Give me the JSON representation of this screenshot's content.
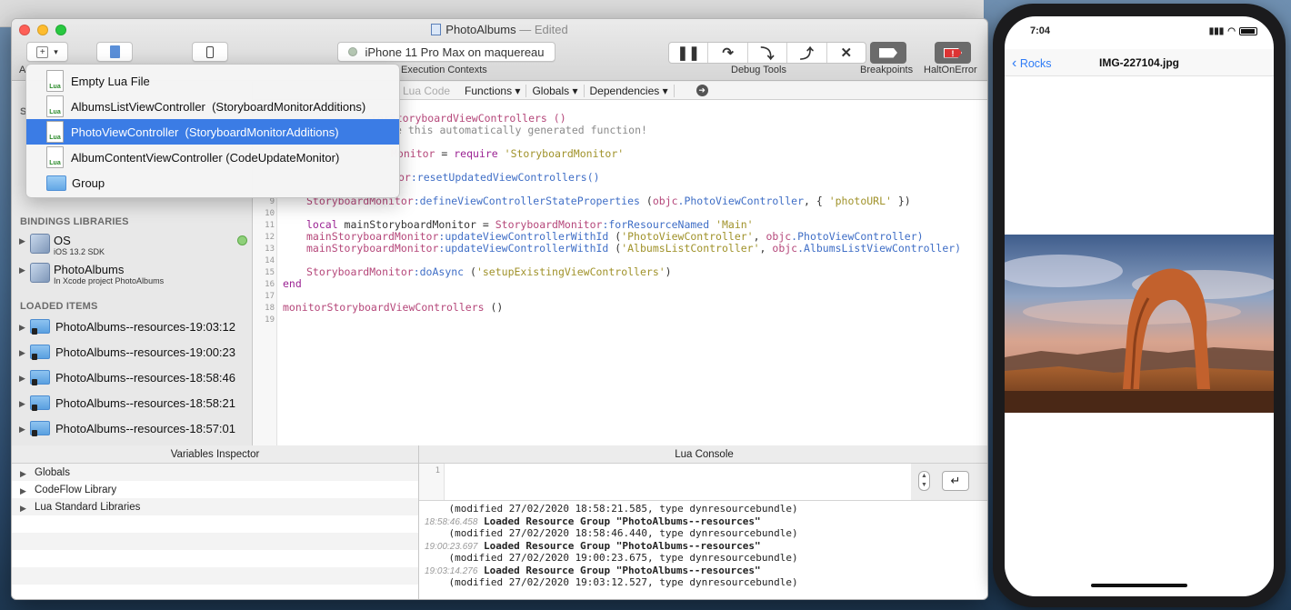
{
  "window": {
    "title": "PhotoAlbums",
    "edited": "— Edited"
  },
  "toolbar": {
    "device": "iPhone 11 Pro Max on maquereau",
    "execution_contexts_label": "Execution Contexts",
    "debug_tools_label": "Debug Tools",
    "breakpoints_label": "Breakpoints",
    "halt_on_error_label": "HaltOnError",
    "partial_label": "A"
  },
  "menu": {
    "items": [
      {
        "label": "Empty Lua File",
        "icon": "lua-file-icon"
      },
      {
        "label": "AlbumsListViewController  (StoryboardMonitorAdditions)",
        "icon": "lua-file-icon"
      },
      {
        "label": "PhotoViewController  (StoryboardMonitorAdditions)",
        "icon": "lua-file-icon",
        "selected": true
      },
      {
        "label": "AlbumContentViewController (CodeUpdateMonitor)",
        "icon": "lua-file-icon"
      },
      {
        "label": "Group",
        "icon": "folder-icon"
      }
    ]
  },
  "editor_bar": {
    "lua_code": "Lua Code",
    "functions": "Functions",
    "globals": "Globals",
    "dependencies": "Dependencies"
  },
  "sidebar": {
    "partial_section": "S",
    "bindings_title": "BINDINGS LIBRARIES",
    "libraries": [
      {
        "name": "OS",
        "sub": "iOS 13.2 SDK"
      },
      {
        "name": "PhotoAlbums",
        "sub": "In Xcode project PhotoAlbums"
      }
    ],
    "loaded_title": "LOADED ITEMS",
    "loaded_items": [
      "PhotoAlbums--resources-19:03:12",
      "PhotoAlbums--resources-19:00:23",
      "PhotoAlbums--resources-18:58:46",
      "PhotoAlbums--resources-18:58:21",
      "PhotoAlbums--resources-18:57:01"
    ]
  },
  "code": {
    "line_numbers": [
      "9",
      "10",
      "11",
      "12",
      "13",
      "14",
      "15",
      "16",
      "17",
      "18",
      "19"
    ],
    "l1a": "torStoryboardViewControllers ()",
    "l2a": "e this automatically generated function!",
    "l3a": "Monitor",
    "l3b": " = ",
    "l3c": "require",
    "l3d": " 'StoryboardMonitor'",
    "l4a": "or",
    "l4b": ":resetUpdatedViewControllers()",
    "l5a": "StoryboardMonitor",
    "l5b": ":defineViewControllerStateProperties",
    "l5c": " (",
    "l5d": "objc",
    "l5e": ".PhotoViewController",
    "l5f": ", { ",
    "l5g": "'photoURL'",
    "l5h": " })",
    "l6a": "local",
    "l6b": " mainStoryboardMonitor",
    "l6c": " = ",
    "l6d": "StoryboardMonitor",
    "l6e": ":forResourceNamed",
    "l6f": " 'Main'",
    "l7a": "mainStoryboardMonitor",
    "l7b": ":updateViewControllerWithId",
    "l7c": " (",
    "l7d": "'PhotoViewController'",
    "l7e": ", ",
    "l7f": "objc",
    "l7g": ".PhotoViewController)",
    "l8a": "mainStoryboardMonitor",
    "l8b": ":updateViewControllerWithId",
    "l8c": " (",
    "l8d": "'AlbumsListController'",
    "l8e": ", ",
    "l8f": "objc",
    "l8g": ".AlbumsListViewController)",
    "l9a": "StoryboardMonitor",
    "l9b": ":doAsync",
    "l9c": " (",
    "l9d": "'setupExistingViewControllers'",
    "l9e": ")",
    "l10": "end",
    "l11a": "monitorStoryboardViewControllers",
    "l11b": " ()"
  },
  "variables": {
    "title": "Variables Inspector",
    "rows": [
      "Globals",
      "CodeFlow Library",
      "Lua Standard Libraries"
    ]
  },
  "console": {
    "title": "Lua Console",
    "input_line": "1",
    "lines": [
      {
        "ts": "",
        "text": "    (modified 27/02/2020 18:58:21.585, type dynresourcebundle)",
        "bold": false
      },
      {
        "ts": "18:58:46.458",
        "text": " Loaded Resource Group \"PhotoAlbums--resources\"",
        "bold": true
      },
      {
        "ts": "",
        "text": "    (modified 27/02/2020 18:58:46.440, type dynresourcebundle)",
        "bold": false
      },
      {
        "ts": "19:00:23.697",
        "text": " Loaded Resource Group \"PhotoAlbums--resources\"",
        "bold": true
      },
      {
        "ts": "",
        "text": "    (modified 27/02/2020 19:00:23.675, type dynresourcebundle)",
        "bold": false
      },
      {
        "ts": "19:03:14.276",
        "text": " Loaded Resource Group \"PhotoAlbums--resources\"",
        "bold": true
      },
      {
        "ts": "",
        "text": "    (modified 27/02/2020 19:03:12.527, type dynresourcebundle)",
        "bold": false
      }
    ]
  },
  "phone": {
    "time": "7:04",
    "back_label": "Rocks",
    "nav_title": "IMG-227104.jpg"
  },
  "colors": {
    "accent": "#3b7ce5",
    "ios_tint": "#2f7cf6"
  }
}
